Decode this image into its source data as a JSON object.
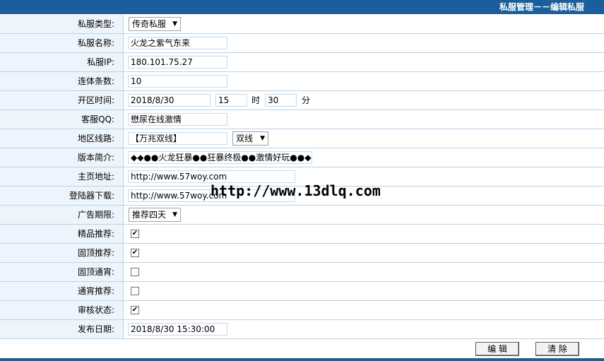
{
  "header": {
    "title": "私服管理－－编辑私服"
  },
  "fields": {
    "type": {
      "label": "私服类型:",
      "value": "传奇私服"
    },
    "name": {
      "label": "私服名称:",
      "value": "火龙之紫气东来"
    },
    "ip": {
      "label": "私服IP:",
      "value": "180.101.75.27"
    },
    "rows": {
      "label": "连体条数:",
      "value": "10"
    },
    "open_time": {
      "label": "开区时间:",
      "date": "2018/8/30",
      "hour": "15",
      "hour_unit": "时",
      "minute": "30",
      "minute_unit": "分"
    },
    "qq": {
      "label": "客服QQ:",
      "value": "懋尿在线激情"
    },
    "region": {
      "label": "地区线路:",
      "value": "【万兆双线】",
      "line": "双线"
    },
    "intro": {
      "label": "版本简介:",
      "value": "◆◆●●火龙狂暴●●狂暴终极●●激情好玩●●◆◆"
    },
    "homepage": {
      "label": "主页地址:",
      "value": "http://www.57woy.com"
    },
    "download": {
      "label": "登陆器下载:",
      "value": "http://www.57woy.com"
    },
    "ad_period": {
      "label": "广告期限:",
      "value": "推荐四天"
    },
    "featured": {
      "label": "精品推荐:",
      "checked": "✔"
    },
    "pinned": {
      "label": "固顶推荐:",
      "checked": "✔"
    },
    "pinned_overnight": {
      "label": "固顶通宵:",
      "checked": ""
    },
    "overnight": {
      "label": "通宵推荐:",
      "checked": ""
    },
    "review": {
      "label": "审核状态:",
      "checked": "✔"
    },
    "publish_date": {
      "label": "发布日期:",
      "value": "2018/8/30 15:30:00"
    }
  },
  "watermark": "http://www.13dlq.com",
  "buttons": {
    "edit": "编 辑",
    "clear": "清 除"
  }
}
